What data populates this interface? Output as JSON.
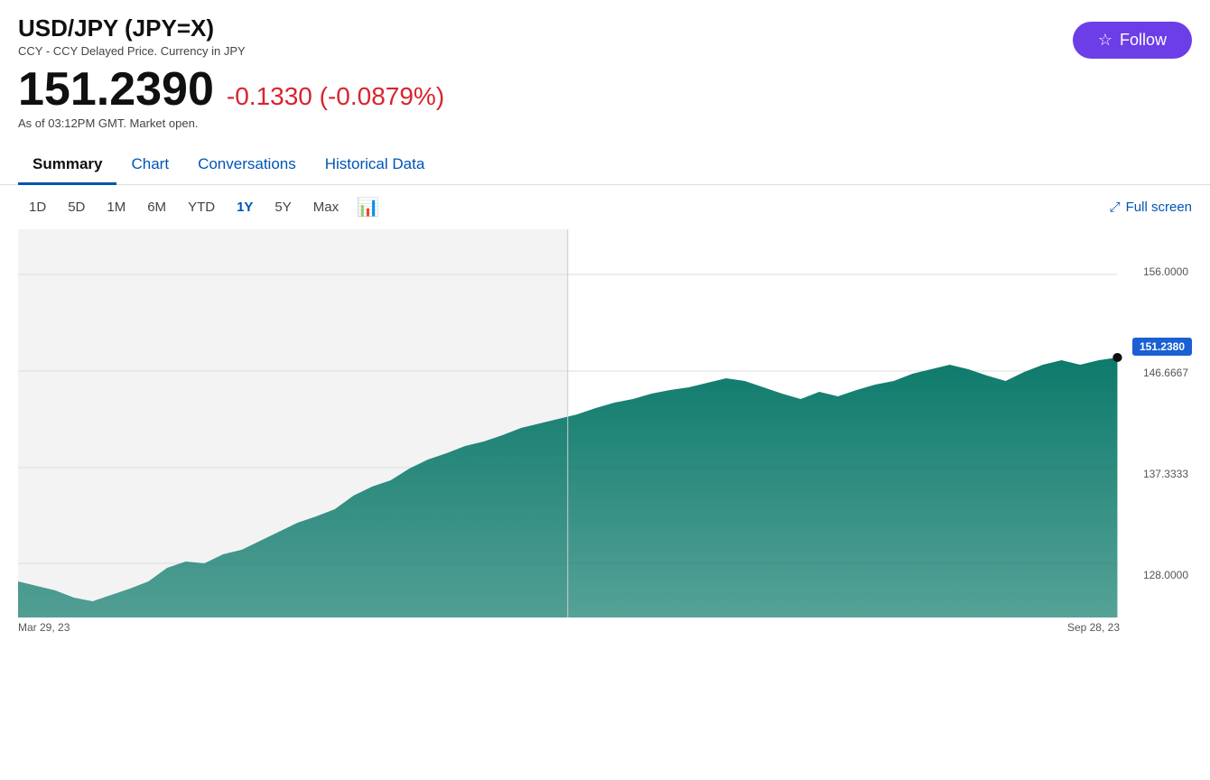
{
  "header": {
    "ticker_title": "USD/JPY (JPY=X)",
    "subtitle": "CCY - CCY Delayed Price. Currency in JPY",
    "follow_label": "Follow",
    "star_char": "☆"
  },
  "price": {
    "main": "151.2390",
    "change": "-0.1330",
    "change_pct": "(-0.0879%)",
    "timestamp": "As of 03:12PM GMT. Market open."
  },
  "tabs": [
    {
      "id": "summary",
      "label": "Summary",
      "active": true
    },
    {
      "id": "chart",
      "label": "Chart",
      "active": false
    },
    {
      "id": "conversations",
      "label": "Conversations",
      "active": false
    },
    {
      "id": "historical",
      "label": "Historical Data",
      "active": false
    }
  ],
  "chart_controls": {
    "time_buttons": [
      {
        "label": "1D",
        "active": false
      },
      {
        "label": "5D",
        "active": false
      },
      {
        "label": "1M",
        "active": false
      },
      {
        "label": "6M",
        "active": false
      },
      {
        "label": "YTD",
        "active": false
      },
      {
        "label": "1Y",
        "active": true
      },
      {
        "label": "5Y",
        "active": false
      },
      {
        "label": "Max",
        "active": false
      }
    ],
    "fullscreen_label": "Full screen",
    "fullscreen_icon": "⤢"
  },
  "chart": {
    "current_price_badge": "151.2380",
    "y_labels": [
      "156.0000",
      "146.6667",
      "137.3333",
      "128.0000"
    ],
    "x_labels": [
      "Mar 29, 23",
      "Sep 28, 23"
    ],
    "accent_color": "#0d7a6b",
    "shaded_color": "#e8e8e8"
  }
}
